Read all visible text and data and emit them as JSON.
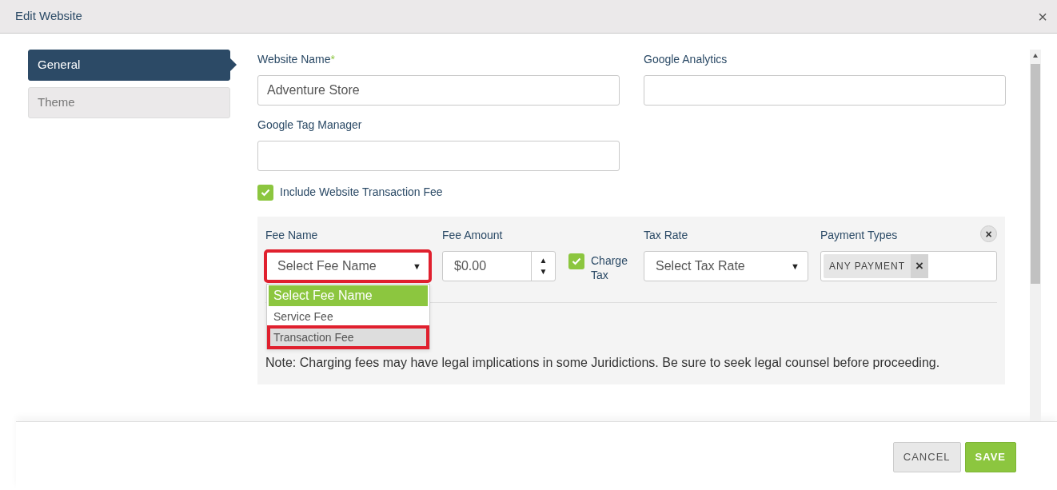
{
  "window": {
    "title": "Edit Website",
    "close": "×"
  },
  "sidebar": {
    "items": [
      {
        "label": "General",
        "selected": true
      },
      {
        "label": "Theme",
        "selected": false
      }
    ]
  },
  "fields": [
    {
      "label": "Website Name",
      "required_mark": "*",
      "value": "Adventure Store"
    },
    {
      "label": "Google Analytics"
    },
    {
      "label": "Google Tag Manager"
    }
  ],
  "include_fee": {
    "label": "Include Website Transaction Fee",
    "checked": true
  },
  "fee": {
    "fee_name": {
      "label": "Fee Name",
      "value": "Select Fee Name",
      "caret": "▼",
      "highlighted": true,
      "options": [
        {
          "label": "Select Fee Name",
          "selected": true,
          "highlighted": false
        },
        {
          "label": "Service Fee",
          "selected": false,
          "highlighted": false
        },
        {
          "label": "Transaction Fee",
          "selected": false,
          "highlighted": true
        }
      ]
    },
    "fee_amount": {
      "label": "Fee Amount",
      "value": "$0.00",
      "up": "▲",
      "down": "▼"
    },
    "charge_tax": {
      "label": "Charge Tax",
      "checked": true
    },
    "tax_rate": {
      "label": "Tax Rate",
      "value": "Select Tax Rate",
      "caret": "▼"
    },
    "payment_types": {
      "label": "Payment Types",
      "tags": [
        "ANY PAYMENT"
      ],
      "tag_remove": "×"
    },
    "remove": "×",
    "note": "Note: Charging fees may have legal implications in some Juridictions. Be sure to seek legal counsel before proceeding."
  },
  "buttons": [
    {
      "label": "CANCEL",
      "kind": "secondary"
    },
    {
      "label": "SAVE",
      "kind": "primary"
    }
  ]
}
